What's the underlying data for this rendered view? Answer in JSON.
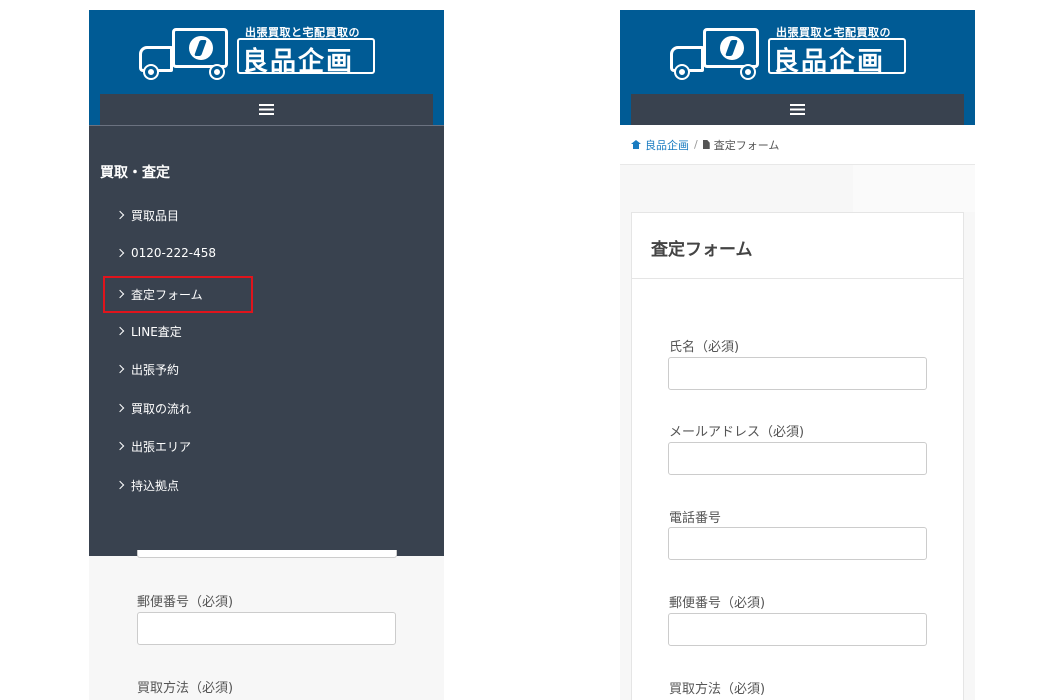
{
  "brand": {
    "tagline": "出張買取と宅配買取の",
    "name": "良品企画"
  },
  "colors": {
    "header": "#005b95",
    "menu_bar": "#39424f",
    "highlight": "#e0141c",
    "link": "#1a7cc1"
  },
  "drawer": {
    "title": "買取・査定",
    "items": [
      {
        "label": "買取品目"
      },
      {
        "label": "0120-222-458"
      },
      {
        "label": "査定フォーム"
      },
      {
        "label": "LINE査定"
      },
      {
        "label": "出張予約"
      },
      {
        "label": "買取の流れ"
      },
      {
        "label": "出張エリア"
      },
      {
        "label": "持込拠点"
      }
    ]
  },
  "breadcrumb": {
    "home": "良品企画",
    "separator": "/",
    "current": "査定フォーム"
  },
  "form": {
    "title": "査定フォーム",
    "fields": [
      {
        "label": "氏名（必須)"
      },
      {
        "label": "メールアドレス（必須)"
      },
      {
        "label": "電話番号"
      },
      {
        "label": "郵便番号（必須)"
      },
      {
        "label": "買取方法（必須)"
      }
    ]
  }
}
